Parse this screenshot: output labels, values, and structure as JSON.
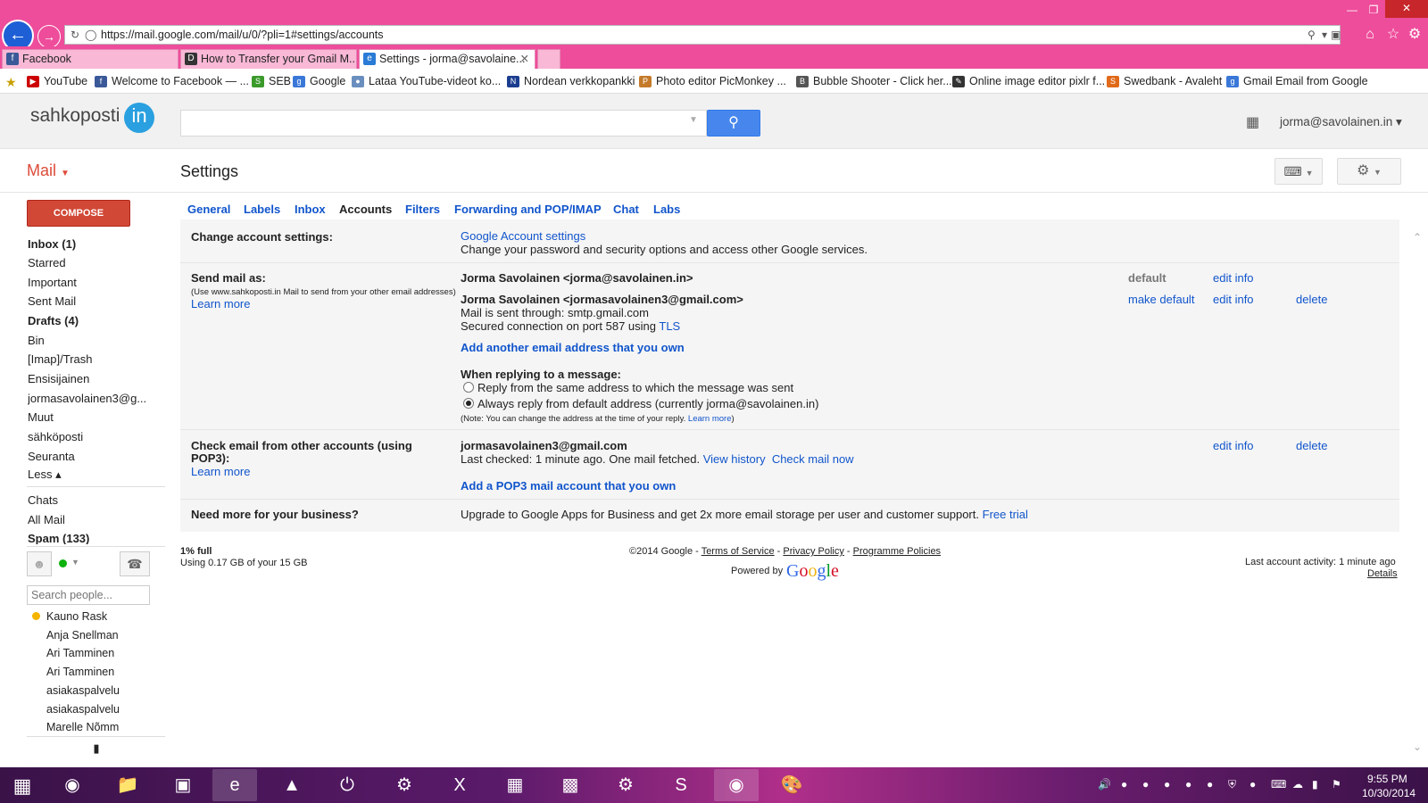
{
  "browser": {
    "url": "https://mail.google.com/mail/u/0/?pli=1#settings/accounts",
    "tabs": [
      {
        "label": "Facebook"
      },
      {
        "label": "How to Transfer your Gmail M..."
      },
      {
        "label": "Settings - jorma@savolaine..."
      }
    ],
    "favorites": [
      "YouTube",
      "Welcome to Facebook — ...",
      "SEB",
      "Google",
      "Lataa YouTube-videot ko...",
      "Nordean verkkopankki",
      "Photo editor  PicMonkey ...",
      "Bubble Shooter - Click her...",
      "Online image editor pixlr f...",
      "Swedbank - Avaleht",
      "Gmail Email from Google"
    ]
  },
  "header": {
    "logo_text": "sahkoposti",
    "logo_badge": "in",
    "account": "jorma@savolainen.in"
  },
  "toolbar": {
    "mail_label": "Mail",
    "page_title": "Settings"
  },
  "nav": {
    "compose": "COMPOSE",
    "items": [
      "Inbox (1)",
      "Starred",
      "Important",
      "Sent Mail",
      "Drafts (4)",
      "Bin",
      "[Imap]/Trash",
      "Ensisijainen",
      "jormasavolainen3@g...",
      "Muut",
      "sähköposti",
      "Seuranta",
      "Less ▴"
    ],
    "items2": [
      "Chats",
      "All Mail",
      "Spam (133)"
    ],
    "people_placeholder": "Search people...",
    "contacts": [
      "Kauno Rask",
      "Anja Snellman",
      "Ari Tamminen",
      "Ari Tamminen",
      "asiakaspalvelu",
      "asiakaspalvelu",
      "Marelle Nõmm"
    ]
  },
  "settings_tabs": [
    "General",
    "Labels",
    "Inbox",
    "Accounts",
    "Filters",
    "Forwarding and POP/IMAP",
    "Chat",
    "Labs"
  ],
  "account_settings": {
    "change_label": "Change account settings:",
    "google_account_link": "Google Account settings",
    "google_account_desc": "Change your password and security options and access other Google services.",
    "send_label": "Send mail as:",
    "send_note": "(Use www.sahkoposti.in Mail to send from your other email addresses)",
    "learn_more": "Learn more",
    "addr1": "Jorma Savolainen <jorma@savolainen.in>",
    "addr1_status": "default",
    "edit_info": "edit info",
    "addr2": "Jorma Savolainen <jormasavolainen3@gmail.com>",
    "make_default": "make default",
    "delete": "delete",
    "smtp_line": "Mail is sent through: smtp.gmail.com",
    "secured_line": "Secured connection on port 587 using",
    "tls": "TLS",
    "add_address": "Add another email address that you own",
    "reply_heading": "When replying to a message:",
    "reply_same": "Reply from the same address to which the message was sent",
    "reply_default": "Always reply from default address (currently jorma@savolainen.in)",
    "reply_note": "(Note: You can change the address at the time of your reply.",
    "reply_note_link": "Learn more",
    "reply_note_end": ")",
    "pop3_label_1": "Check email from other accounts (using",
    "pop3_label_2": "POP3):",
    "pop3_account": "jormasavolainen3@gmail.com",
    "pop3_status": "Last checked: 1 minute ago. One mail fetched.",
    "view_history": "View history",
    "check_now": "Check mail now",
    "add_pop3": "Add a POP3 mail account that you own",
    "business_label": "Need more for your business?",
    "business_text": "Upgrade to Google Apps for Business and get 2x more email storage per user and customer support.",
    "free_trial": "Free trial"
  },
  "footer": {
    "usage_pct": "1% full",
    "usage_text": "Using 0.17 GB of your 15 GB",
    "copyright": "©2014 Google - ",
    "terms": "Terms of Service",
    "sep": " - ",
    "privacy": "Privacy Policy",
    "policies": "Programme Policies",
    "powered": "Powered by",
    "last_activity": "Last account activity: 1 minute ago",
    "details": "Details"
  },
  "taskbar": {
    "time": "9:55 PM",
    "date": "10/30/2014"
  },
  "colors": {
    "browser_chrome": "#ee4d9b",
    "compose": "#d14836",
    "link": "#1155cc",
    "search_button": "#4787ed"
  }
}
